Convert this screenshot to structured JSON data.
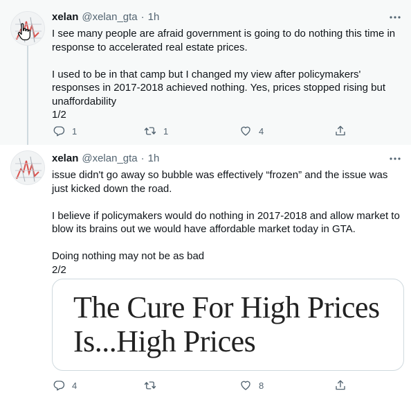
{
  "tweets": [
    {
      "name": "xelan",
      "handle": "@xelan_gta",
      "separator": "·",
      "time": "1h",
      "text": "I see many people are afraid government is going to do nothing this time in response to accelerated real estate prices.\n\nI used to be in that camp but I changed my view after policymakers' responses in 2017-2018 achieved nothing. Yes, prices stopped rising but unaffordability\n1/2",
      "replies": "1",
      "retweets": "1",
      "likes": "4"
    },
    {
      "name": "xelan",
      "handle": "@xelan_gta",
      "separator": "·",
      "time": "1h",
      "text": "issue didn't go away so bubble was effectively “frozen” and the issue was just kicked down the road.\n\nI believe if policymakers would do nothing in 2017-2018 and allow market to blow its brains out we would have affordable market today in GTA.\n\nDoing nothing may not be as bad\n2/2",
      "replies": "4",
      "retweets": "",
      "likes": "8",
      "card": {
        "line1": "The Cure For High Prices",
        "line2": "Is...High Prices"
      }
    }
  ],
  "icons": {
    "more": "more-icon",
    "reply": "reply-icon",
    "retweet": "retweet-icon",
    "like": "like-icon",
    "share": "share-icon"
  },
  "colors": {
    "secondary_text": "#536471",
    "thread_line": "#cfd9de",
    "hover_bg": "#f7f9f9"
  }
}
